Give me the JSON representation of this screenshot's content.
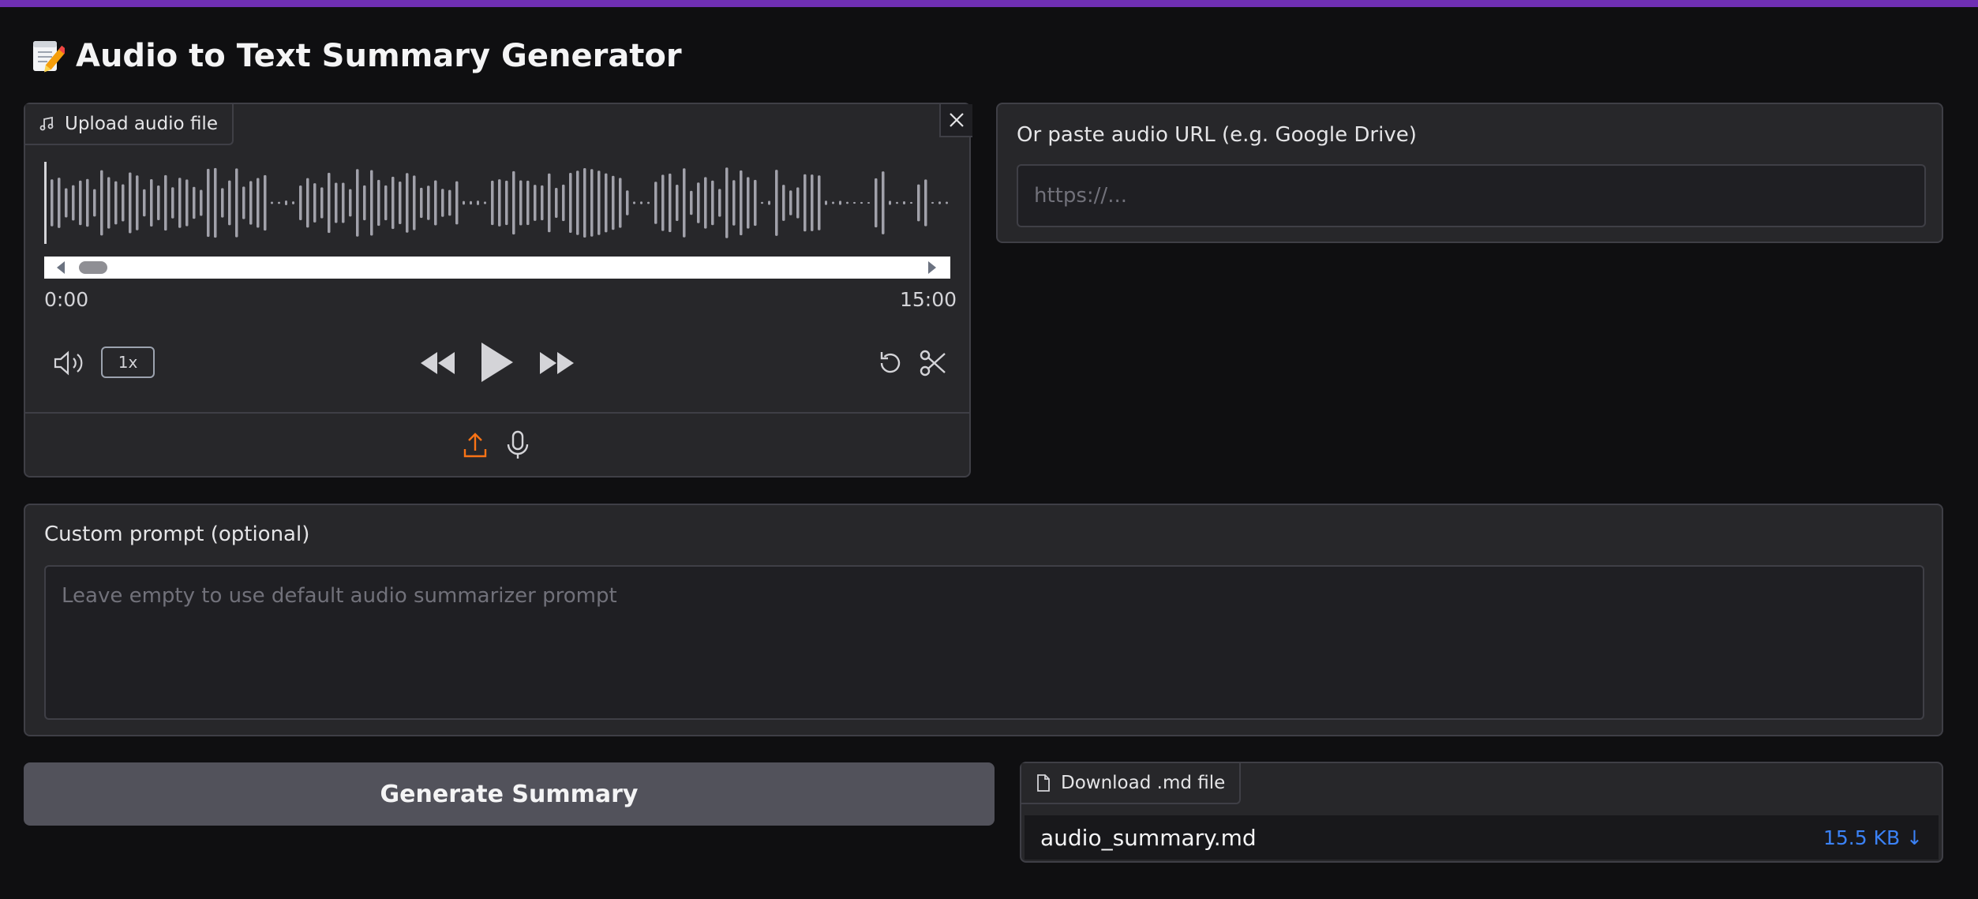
{
  "app": {
    "title": "Audio to Text Summary Generator",
    "title_icon": "memo-pencil-icon",
    "accent_color": "#6f2fb3"
  },
  "audio": {
    "tab_label": "Upload audio file",
    "time_current": "0:00",
    "time_total": "15:00",
    "playback_rate": "1x"
  },
  "url": {
    "label": "Or paste audio URL (e.g. Google Drive)",
    "placeholder": "https://..."
  },
  "prompt": {
    "label": "Custom prompt (optional)",
    "placeholder": "Leave empty to use default audio summarizer prompt"
  },
  "generate": {
    "label": "Generate Summary"
  },
  "download": {
    "tab_label": "Download .md file",
    "filename": "audio_summary.md",
    "size": "15.5 KB ↓"
  },
  "colors": {
    "upload_icon": "#f97316",
    "link": "#3b82f6"
  }
}
